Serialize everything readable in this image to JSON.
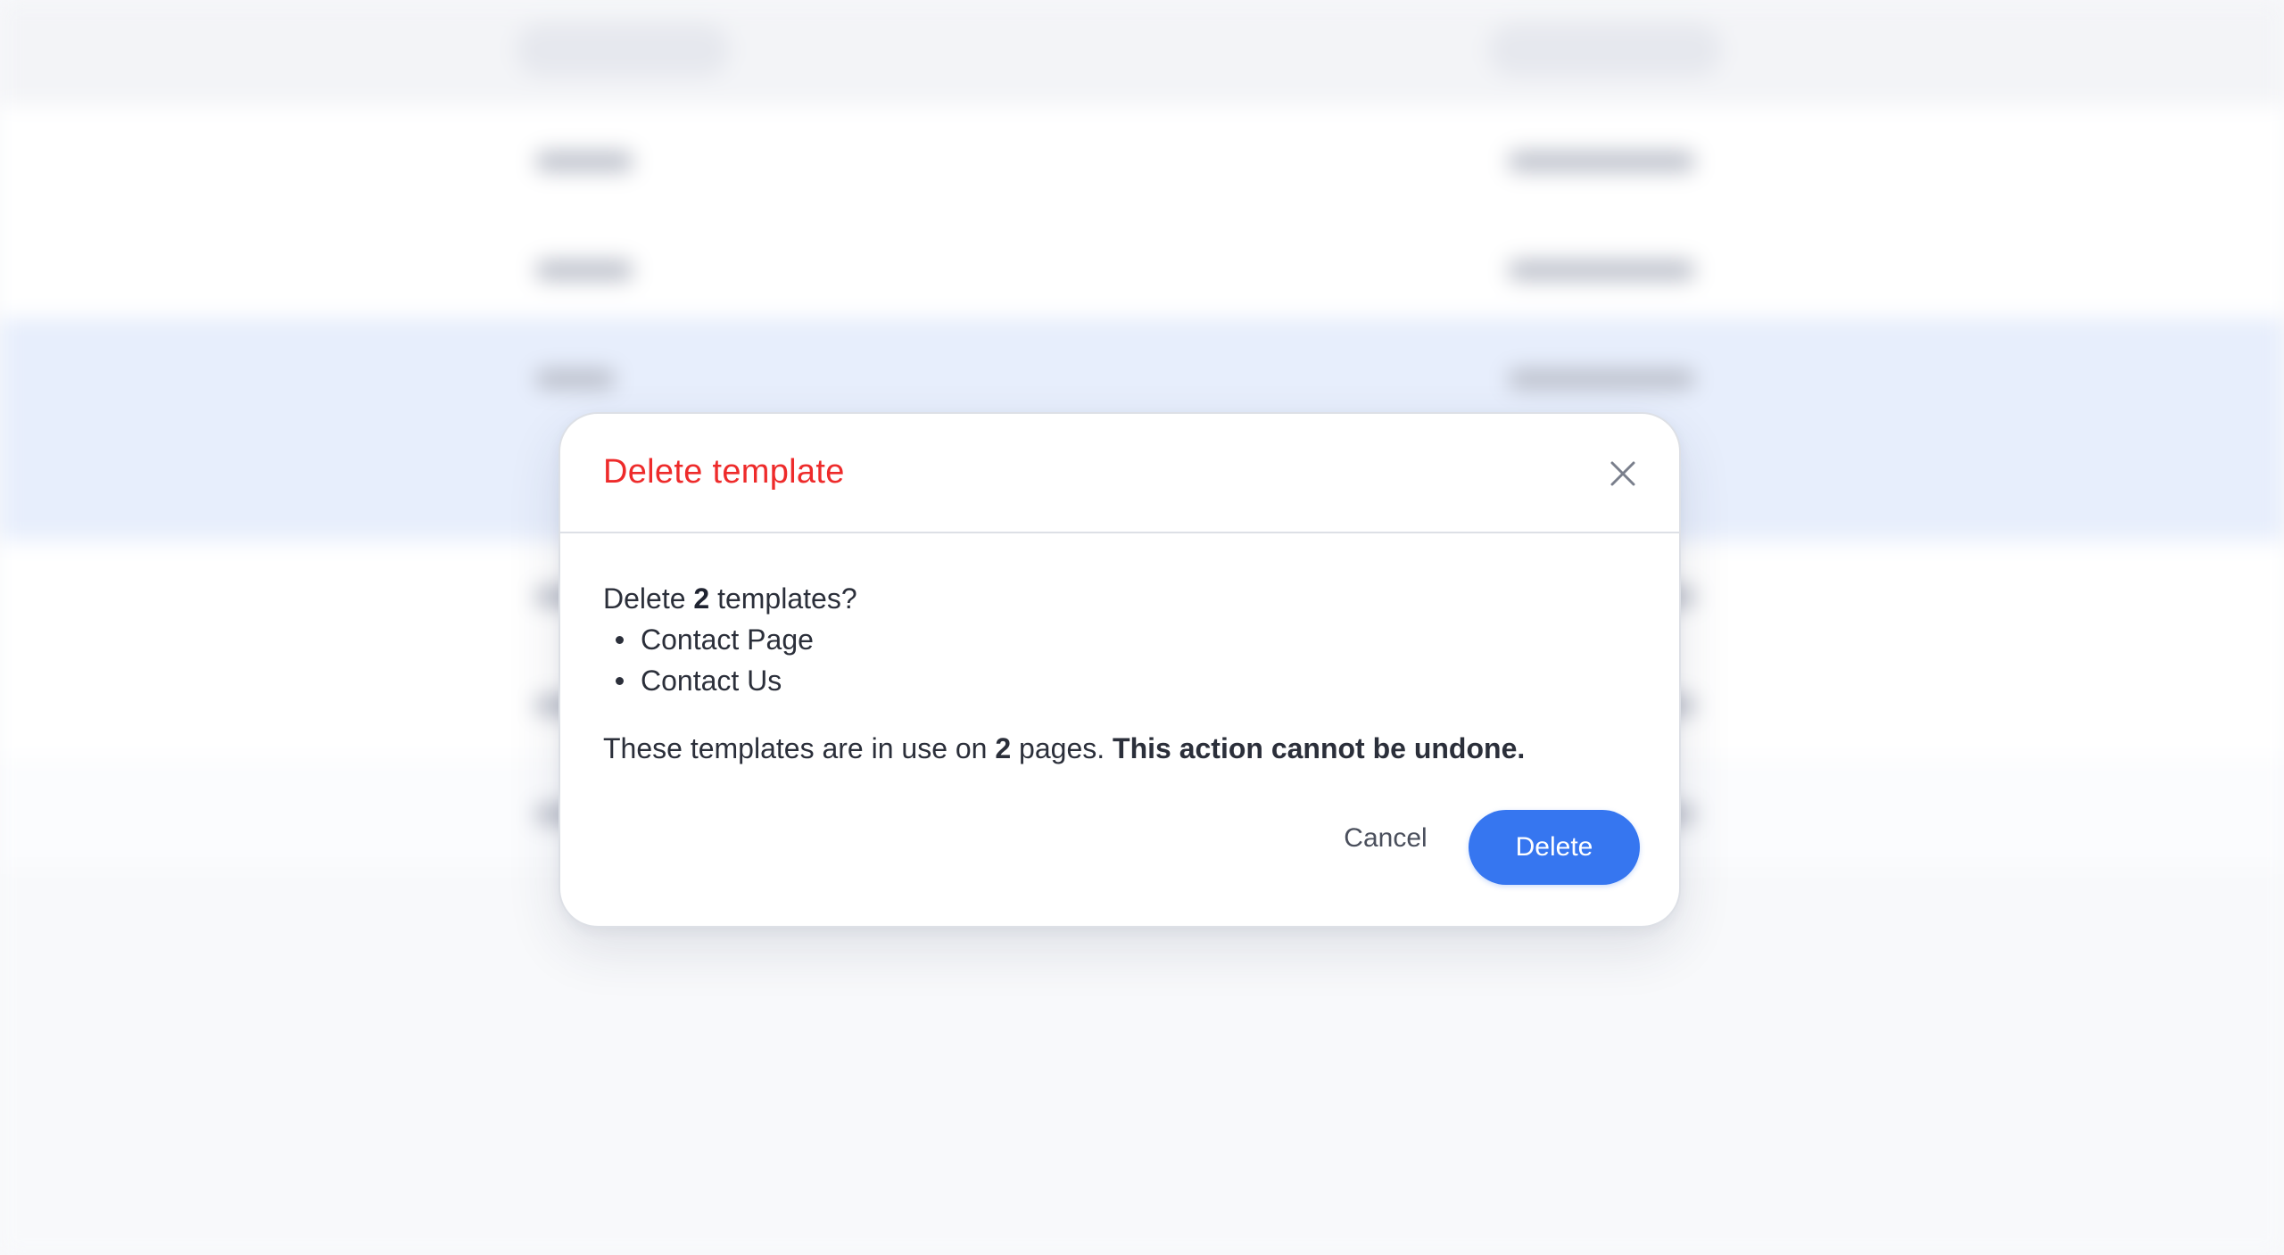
{
  "dialog": {
    "title": "Delete template",
    "close_icon": "close-icon",
    "question_prefix": "Delete ",
    "question_count": "2",
    "question_suffix": " templates?",
    "templates": [
      "Contact Page",
      "Contact Us"
    ],
    "usage_prefix": "These templates are in use on ",
    "usage_count": "2",
    "usage_suffix": " pages. ",
    "warning": "This action cannot be undone.",
    "cancel_label": "Cancel",
    "delete_label": "Delete"
  },
  "colors": {
    "title": "#ee2b2b",
    "primary": "#3676f0",
    "text": "#2b2f3a",
    "border": "#dde0e6",
    "backdrop": "#f8f9fb",
    "selected_row": "#e7eefc"
  }
}
